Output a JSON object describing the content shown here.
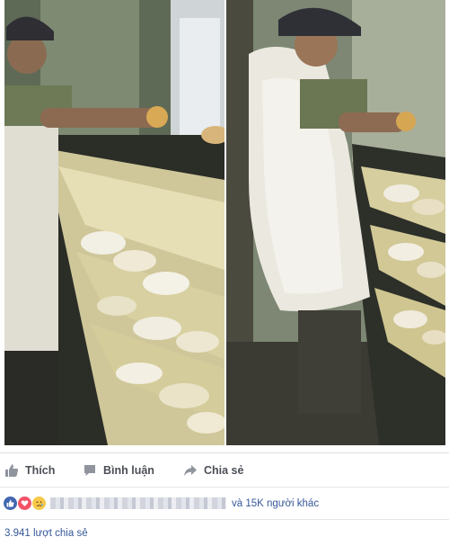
{
  "post": {
    "photos": [
      {
        "name": "photo-left"
      },
      {
        "name": "photo-right"
      }
    ]
  },
  "actions": {
    "like_label": "Thích",
    "comment_label": "Bình luận",
    "share_label": "Chia sẻ"
  },
  "reactions": {
    "icons": [
      "like-icon",
      "love-icon",
      "sad-icon"
    ],
    "others_text": "và 15K người khác"
  },
  "shares": {
    "count_text": "3.941 lượt chia sẻ"
  },
  "colors": {
    "link": "#365899",
    "action_text": "#4b4f56",
    "like_badge": "#4267b2",
    "love_badge": "#f25268",
    "sad_badge": "#f7c84a"
  }
}
